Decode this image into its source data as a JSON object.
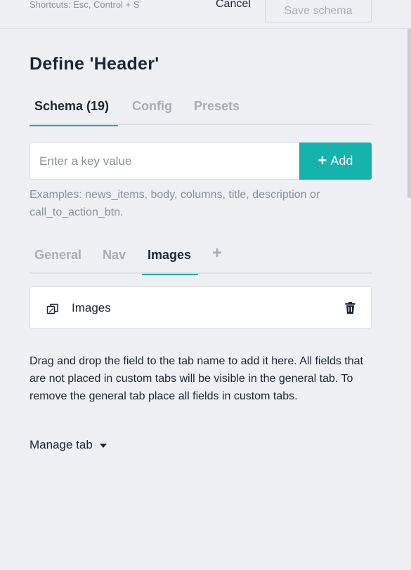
{
  "topbar": {
    "shortcuts": "Shortcuts: Esc, Control + S",
    "cancel_label": "Cancel",
    "save_label": "Save schema"
  },
  "title": "Define 'Header'",
  "main_tabs": [
    {
      "label": "Schema (19)",
      "active": true
    },
    {
      "label": "Config",
      "active": false
    },
    {
      "label": "Presets",
      "active": false
    }
  ],
  "key_input": {
    "value": "",
    "placeholder": "Enter a key value"
  },
  "add_button": {
    "icon": "plus-icon",
    "label": "Add"
  },
  "examples_text": "Examples: news_items, body, columns, title, description or call_to_action_btn.",
  "sub_tabs": [
    {
      "label": "General",
      "active": false
    },
    {
      "label": "Nav",
      "active": false
    },
    {
      "label": "Images",
      "active": true
    },
    {
      "label": "+",
      "active": false
    }
  ],
  "fields": [
    {
      "label": "Images",
      "icon": "copy-icon",
      "action_icon": "trash-icon"
    }
  ],
  "help_text": "Drag and drop the field to the tab name to add it here. All fields that are not placed in custom tabs will be visible in the general tab. To remove the general tab place all fields in custom tabs.",
  "manage_tab_label": "Manage tab",
  "colors": {
    "accent": "#14b3ab",
    "background": "#eef0f4",
    "text": "#1d2633",
    "muted": "#8a919b"
  }
}
